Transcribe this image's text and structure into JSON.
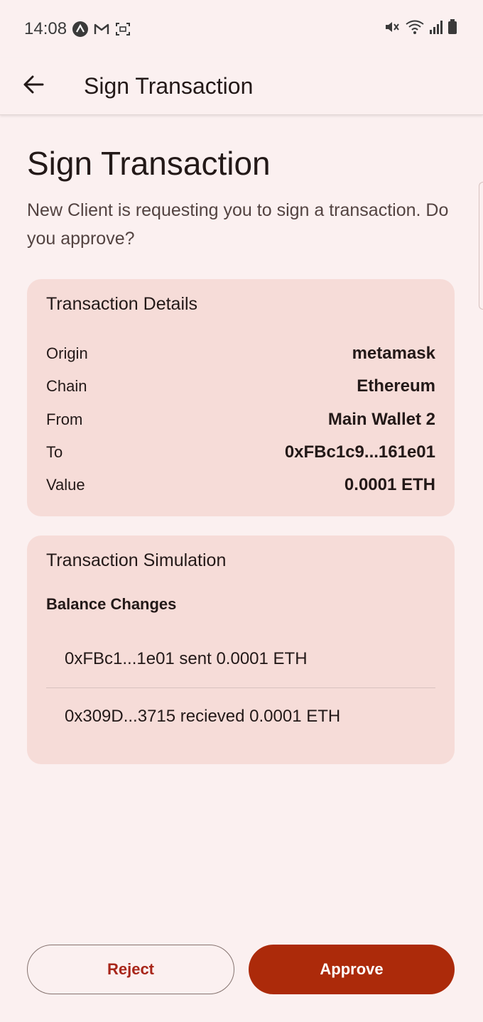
{
  "status_bar": {
    "time": "14:08",
    "icons_left": [
      "app-notification-icon",
      "gmail-icon",
      "screenshot-icon"
    ],
    "icons_right": [
      "mute-icon",
      "wifi-icon",
      "signal-icon",
      "battery-icon"
    ]
  },
  "app_bar": {
    "title": "Sign Transaction",
    "back_icon": "arrow-back-icon"
  },
  "header": {
    "title": "Sign Transaction",
    "subtitle": "New Client is requesting you to sign a transaction. Do you approve?"
  },
  "details": {
    "title": "Transaction Details",
    "rows": [
      {
        "label": "Origin",
        "value": "metamask"
      },
      {
        "label": "Chain",
        "value": "Ethereum"
      },
      {
        "label": "From",
        "value": "Main Wallet 2"
      },
      {
        "label": "To",
        "value": "0xFBc1c9...161e01"
      },
      {
        "label": "Value",
        "value": "0.0001 ETH"
      }
    ]
  },
  "simulation": {
    "title": "Transaction Simulation",
    "balance_heading": "Balance Changes",
    "items": [
      "0xFBc1...1e01 sent 0.0001 ETH",
      "0x309D...3715 recieved 0.0001 ETH"
    ]
  },
  "actions": {
    "reject_label": "Reject",
    "approve_label": "Approve"
  },
  "colors": {
    "background": "#fbf0f0",
    "card": "#f6dcd8",
    "approve": "#ac2a0a",
    "reject_text": "#a8261a"
  }
}
